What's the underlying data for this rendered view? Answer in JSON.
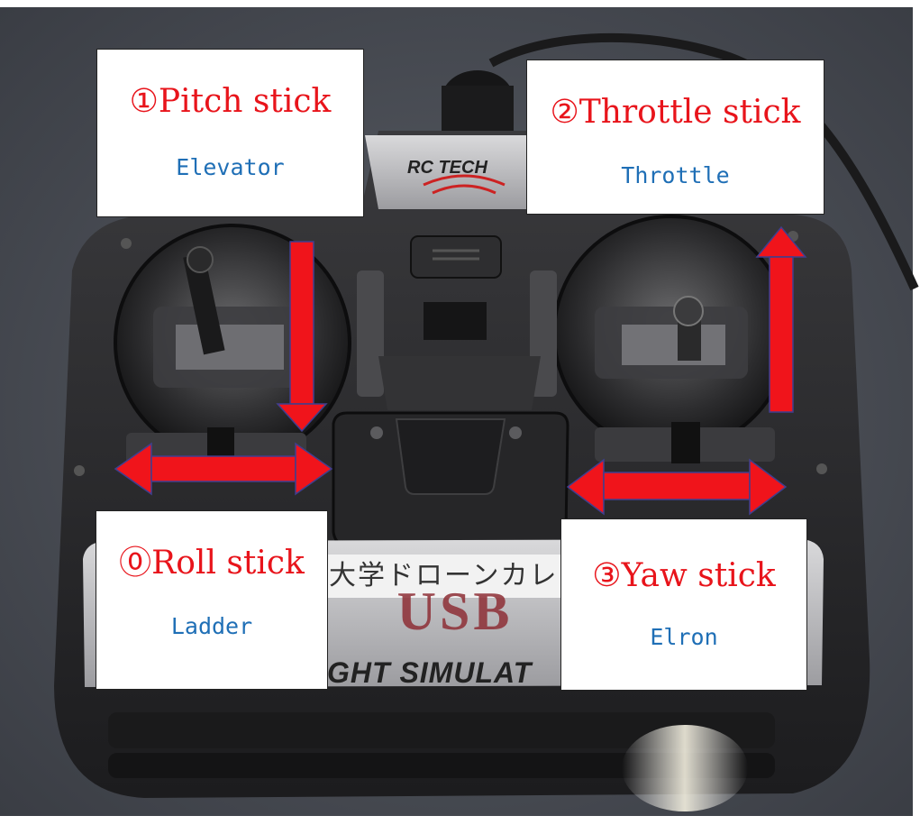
{
  "labels": {
    "pitch": {
      "title": "①Pitch stick",
      "subtitle": "Elevator"
    },
    "throttle": {
      "title": "②Throttle stick",
      "subtitle": "Throttle"
    },
    "roll": {
      "title": "⓪Roll stick",
      "subtitle": "Ladder"
    },
    "yaw": {
      "title": "③Yaw stick",
      "subtitle": "Elron"
    }
  },
  "device": {
    "brand": "RC TECH",
    "sticker_japanese": "大学ドローンカレ",
    "sticker_usb": "USB",
    "sticker_simulator": "GHT SIMULAT"
  },
  "colors": {
    "title_red": "#e8141b",
    "subtitle_blue": "#1f6fb6",
    "arrow_red": "#f0141b",
    "arrow_outline": "#3f3f8f",
    "controller_body": "#2a2a2c",
    "carpet": "#4b4e55"
  }
}
